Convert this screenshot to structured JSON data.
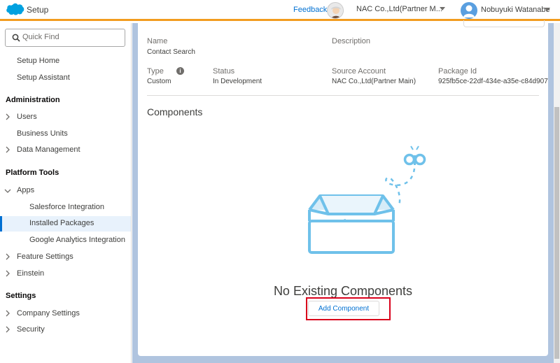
{
  "header": {
    "app_name": "Setup",
    "feedback_label": "Feedback",
    "org_name": "NAC Co.,Ltd(Partner M...",
    "user_name": "Nobuyuki Watanabe"
  },
  "sidebar": {
    "search_placeholder": "Quick Find",
    "items": [
      {
        "label": "Setup Home"
      },
      {
        "label": "Setup Assistant"
      }
    ],
    "sections": [
      {
        "title": "Administration",
        "items": [
          {
            "label": "Users",
            "expandable": true
          },
          {
            "label": "Business Units",
            "expandable": false
          },
          {
            "label": "Data Management",
            "expandable": true
          }
        ]
      },
      {
        "title": "Platform Tools",
        "items": [
          {
            "label": "Apps",
            "expandable": true,
            "expanded": true
          },
          {
            "label": "Salesforce Integration"
          },
          {
            "label": "Installed Packages",
            "active": true
          },
          {
            "label": "Google Analytics Integration"
          },
          {
            "label": "Feature Settings",
            "expandable": true
          },
          {
            "label": "Einstein",
            "expandable": true
          }
        ]
      },
      {
        "title": "Settings",
        "items": [
          {
            "label": "Company Settings",
            "expandable": true
          },
          {
            "label": "Security",
            "expandable": true
          }
        ]
      }
    ]
  },
  "package": {
    "name_label": "Name",
    "name_value": "Contact Search",
    "description_label": "Description",
    "type_label": "Type",
    "type_value": "Custom",
    "status_label": "Status",
    "status_value": "In Development",
    "source_account_label": "Source Account",
    "source_account_value": "NAC Co.,Ltd(Partner Main)",
    "package_id_label": "Package Id",
    "package_id_value": "925fb5ce-22df-434e-a35e-c84d907"
  },
  "components": {
    "title": "Components",
    "empty_title": "No Existing Components",
    "add_button_label": "Add Component"
  },
  "colors": {
    "accent": "#0070d2",
    "header_border": "#f29c1f",
    "highlight": "#d9001b",
    "illustration": "#6fc1ea"
  },
  "icons": {
    "logo": "salesforce-cloud-icon",
    "search": "search-icon",
    "info": "info-icon",
    "chevron": "chevron-right-icon",
    "dropdown": "chevron-down-icon"
  }
}
